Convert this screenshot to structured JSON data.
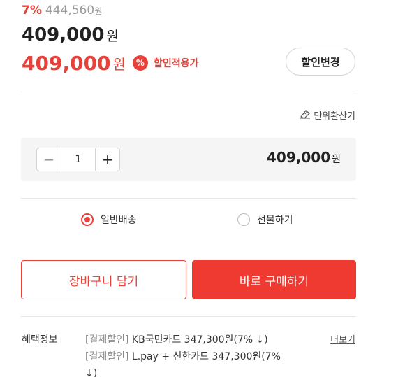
{
  "price": {
    "discount_rate": "7%",
    "original_price": "444,560",
    "original_unit": "원",
    "main_price": "409,000",
    "main_unit": "원",
    "sale_price": "409,000",
    "sale_unit": "원",
    "discount_badge": "%",
    "applied_label": "할인적용가",
    "change_button": "할인변경"
  },
  "unit_convert": {
    "label": "단위환산기",
    "icon": "ruler-icon"
  },
  "quantity": {
    "minus": "−",
    "value": "1",
    "plus": "+",
    "total": "409,000",
    "total_unit": "원"
  },
  "delivery": {
    "options": [
      {
        "label": "일반배송",
        "selected": true
      },
      {
        "label": "선물하기",
        "selected": false
      }
    ]
  },
  "actions": {
    "cart_button": "장바구니 담기",
    "buy_button": "바로 구매하기"
  },
  "benefits": {
    "title": "혜택정보",
    "more": "더보기",
    "items": [
      {
        "tag": "[결제할인]",
        "text": " KB국민카드 347,300원(7% ↓)"
      },
      {
        "tag": "[결제할인]",
        "text": " L.pay + 신한카드 347,300원(7% ↓)"
      }
    ]
  },
  "colors": {
    "accent": "#e8413a",
    "buy_button": "#ee3a30",
    "panel_bg": "#f5f5f5"
  }
}
